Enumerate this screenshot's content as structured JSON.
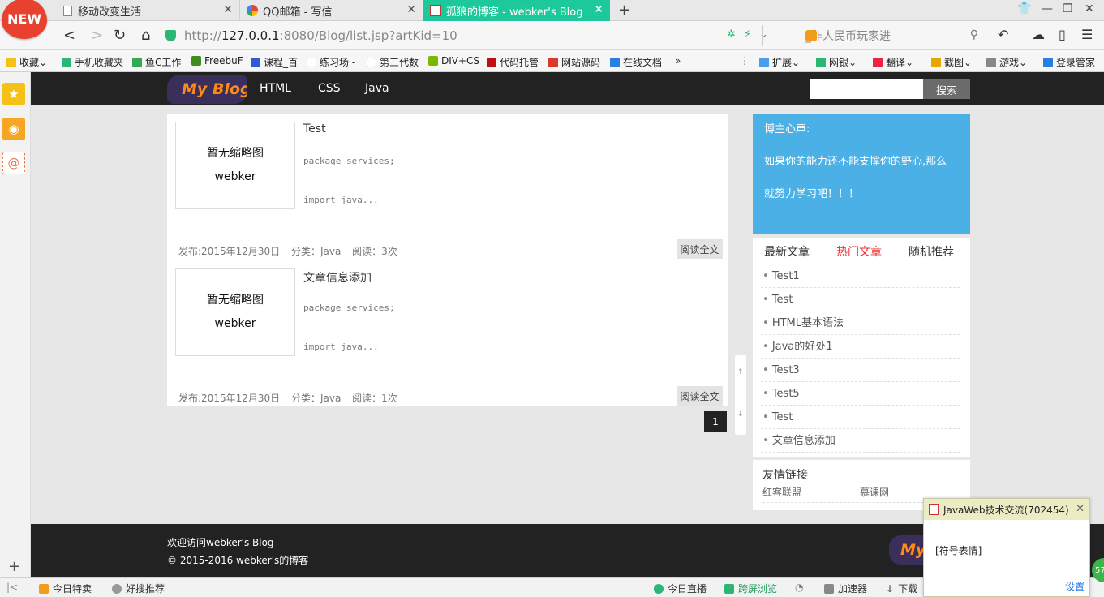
{
  "browser": {
    "new_badge": "NEW",
    "tabs": [
      {
        "title": "移动改变生活"
      },
      {
        "title": "QQ邮箱 - 写信"
      },
      {
        "title": "孤狼的博客 - webker's Blog"
      }
    ],
    "new_tab": "+",
    "address": {
      "url_host": "127.0.0.1",
      "url_prefix": "http://",
      "url_rest": ":8080/Blog/list.jsp?artKid=10"
    },
    "search_placeholder": "_非人民币玩家进",
    "bookmarks": [
      "收藏",
      "手机收藏夹",
      "鱼C工作",
      "FreebuF",
      "课程_百",
      "练习场 -",
      "第三代数",
      "DIV+CS",
      "代码托管",
      "网站源码",
      "在线文档"
    ],
    "bookmarks_more": "»",
    "extensions": [
      "扩展",
      "网银",
      "翻译",
      "截图",
      "游戏",
      "登录管家"
    ]
  },
  "site": {
    "logo_text": "My Blog",
    "nav": [
      "HTML",
      "CSS",
      "Java"
    ],
    "search_button": "搜索",
    "search_value": ""
  },
  "articles": [
    {
      "thumb_line1": "暂无缩略图",
      "thumb_line2": "webker",
      "title": "Test",
      "code_line1": "package services;",
      "code_line2": "import java...",
      "date": "发布:2015年12月30日",
      "category": "分类：Java",
      "reads": "阅读：3次",
      "read_more": "阅读全文"
    },
    {
      "thumb_line1": "暂无缩略图",
      "thumb_line2": "webker",
      "title": "文章信息添加",
      "code_line1": "package services;",
      "code_line2": "import java...",
      "date": "发布:2015年12月30日",
      "category": "分类：Java",
      "reads": "阅读：1次",
      "read_more": "阅读全文"
    }
  ],
  "pager": {
    "current": "1"
  },
  "sidebar": {
    "motto_title": "博主心声:",
    "motto_line1": "如果你的能力还不能支撑你的野心,那么",
    "motto_line2": "就努力学习吧！！！",
    "tabs": [
      "最新文章",
      "热门文章",
      "随机推荐"
    ],
    "articles": [
      "Test1",
      "Test",
      "HTML基本语法",
      "Java的好处1",
      "Test3",
      "Test5",
      "Test",
      "文章信息添加"
    ],
    "friends_title": "友情链接",
    "friends": [
      "红客联盟",
      "慕课网"
    ]
  },
  "footer": {
    "line1": "欢迎访问webker's Blog",
    "line2": "© 2015-2016 webker's的博客",
    "logo_text": "My"
  },
  "statusbar": {
    "left": [
      "今日特卖",
      "好搜推荐"
    ],
    "right": [
      "今日直播",
      "跨屏浏览",
      "加速器",
      "下载"
    ]
  },
  "qq_popup": {
    "title": "JavaWeb技术交流(702454)",
    "message": "[符号表情]",
    "settings": "设置",
    "badge": "57"
  },
  "colors": {
    "tab_active": "#1dc99a",
    "motto_bg": "#4ab0e6",
    "nav_bg": "#222222",
    "hot_tab": "#ee3333"
  }
}
